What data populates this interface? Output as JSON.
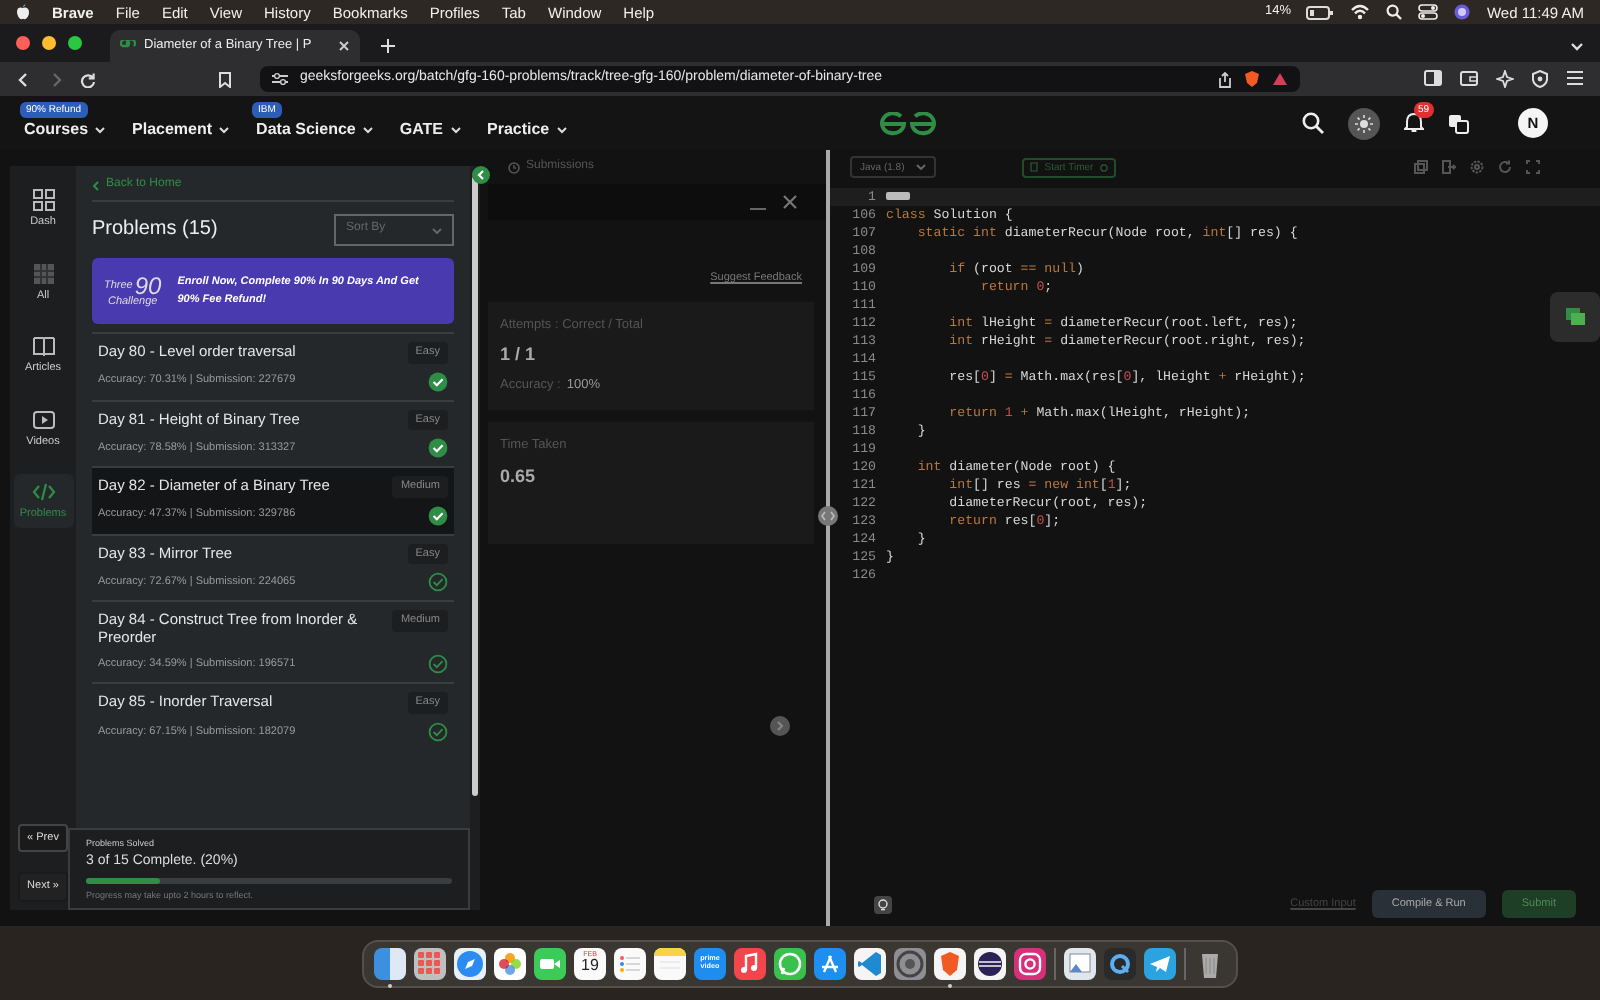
{
  "menubar": {
    "app": "Brave",
    "menus": [
      "File",
      "Edit",
      "View",
      "History",
      "Bookmarks",
      "Profiles",
      "Tab",
      "Window",
      "Help"
    ],
    "battery": "14%",
    "clock": "Wed 11:49 AM"
  },
  "browser": {
    "tab_title": "Diameter of a Binary Tree | P",
    "url": "geeksforgeeks.org/batch/gfg-160-problems/track/tree-gfg-160/problem/diameter-of-binary-tree"
  },
  "site_nav": {
    "items": [
      {
        "label": "Courses",
        "badge": "90% Refund"
      },
      {
        "label": "Placement"
      },
      {
        "label": "Data Science",
        "badge": "IBM"
      },
      {
        "label": "GATE"
      },
      {
        "label": "Practice"
      }
    ],
    "notifications": "59",
    "avatar": "N"
  },
  "sidebar": {
    "items": [
      {
        "kind": "dash",
        "label": "Dash",
        "selected": false
      },
      {
        "kind": "all",
        "label": "All",
        "selected": false
      },
      {
        "kind": "articles",
        "label": "Articles",
        "selected": false
      },
      {
        "kind": "videos",
        "label": "Videos",
        "selected": false
      },
      {
        "kind": "problems",
        "label": "Problems",
        "selected": true
      }
    ],
    "prev": "« Prev",
    "next": "Next »"
  },
  "problems": {
    "back": "Back to Home",
    "title": "Problems (15)",
    "sort_placeholder": "Sort By",
    "banner": {
      "logo_top": "Three",
      "logo_number": "90",
      "logo_bottom": "Challenge",
      "message": "Enroll Now, Complete 90% In 90 Days And Get 90% Fee Refund!"
    },
    "items": [
      {
        "title": "Day 80 - Level order traversal",
        "difficulty": "Easy",
        "stats": "Accuracy: 70.31% | Submission: 227679",
        "solved": true,
        "selected": false
      },
      {
        "title": "Day 81 - Height of Binary Tree",
        "difficulty": "Easy",
        "stats": "Accuracy: 78.58% | Submission: 313327",
        "solved": true,
        "selected": false
      },
      {
        "title": "Day 82 - Diameter of a Binary Tree",
        "difficulty": "Medium",
        "stats": "Accuracy: 47.37% | Submission: 329786",
        "solved": true,
        "selected": true
      },
      {
        "title": "Day 83 - Mirror Tree",
        "difficulty": "Easy",
        "stats": "Accuracy: 72.67% | Submission: 224065",
        "solved": false,
        "selected": false
      },
      {
        "title": "Day 84 - Construct Tree from Inorder & Preorder",
        "difficulty": "Medium",
        "stats": "Accuracy: 34.59% | Submission: 196571",
        "solved": false,
        "selected": false
      },
      {
        "title": "Day 85 - Inorder Traversal",
        "difficulty": "Easy",
        "stats": "Accuracy: 67.15% | Submission: 182079",
        "solved": false,
        "selected": false
      }
    ],
    "progress": {
      "label": "Problems Solved",
      "text": "3 of 15 Complete. (20%)",
      "level": 0.2,
      "note": "Progress may take upto 2 hours to reflect."
    }
  },
  "result": {
    "tab": "Submissions",
    "link": "Suggest Feedback",
    "cards": [
      {
        "label": "Attempts : Correct / Total",
        "value": "1 / 1",
        "sub_label": "Accuracy :",
        "sub_value": "100%"
      },
      {
        "label": "Time Taken",
        "value": "0.65"
      }
    ]
  },
  "editor": {
    "language": "Java (1.8)",
    "timer": "Start Timer",
    "lines": [
      {
        "num": "1"
      },
      {
        "num": "106",
        "tokens": [
          {
            "kind": "keyword",
            "text": "class"
          },
          {
            "kind": "plain",
            "text": " Solution {"
          }
        ]
      },
      {
        "num": "107",
        "tokens": [
          {
            "kind": "keyword",
            "text": "    static int"
          },
          {
            "kind": "plain",
            "text": " diameterRecur(Node root, "
          },
          {
            "kind": "keyword",
            "text": "int"
          },
          {
            "kind": "plain",
            "text": "[] res) {"
          }
        ]
      },
      {
        "num": "108"
      },
      {
        "num": "109",
        "tokens": [
          {
            "kind": "keyword",
            "text": "        if"
          },
          {
            "kind": "plain",
            "text": " (root "
          },
          {
            "kind": "operator",
            "text": "=="
          },
          {
            "kind": "keyword",
            "text": " null"
          },
          {
            "kind": "plain",
            "text": ")"
          }
        ]
      },
      {
        "num": "110",
        "tokens": [
          {
            "kind": "keyword",
            "text": "            return"
          },
          {
            "kind": "number",
            "text": " 0"
          },
          {
            "kind": "plain",
            "text": ";"
          }
        ]
      },
      {
        "num": "111"
      },
      {
        "num": "112",
        "tokens": [
          {
            "kind": "keyword",
            "text": "        int"
          },
          {
            "kind": "plain",
            "text": " lHeight "
          },
          {
            "kind": "operator",
            "text": "="
          },
          {
            "kind": "plain",
            "text": " diameterRecur(root.left, res);"
          }
        ]
      },
      {
        "num": "113",
        "tokens": [
          {
            "kind": "keyword",
            "text": "        int"
          },
          {
            "kind": "plain",
            "text": " rHeight "
          },
          {
            "kind": "operator",
            "text": "="
          },
          {
            "kind": "plain",
            "text": " diameterRecur(root.right, res);"
          }
        ]
      },
      {
        "num": "114"
      },
      {
        "num": "115",
        "tokens": [
          {
            "kind": "plain",
            "text": "        res["
          },
          {
            "kind": "number",
            "text": "0"
          },
          {
            "kind": "plain",
            "text": "] "
          },
          {
            "kind": "operator",
            "text": "="
          },
          {
            "kind": "plain",
            "text": " Math.max(res["
          },
          {
            "kind": "number",
            "text": "0"
          },
          {
            "kind": "plain",
            "text": "], lHeight "
          },
          {
            "kind": "operator",
            "text": "+"
          },
          {
            "kind": "plain",
            "text": " rHeight);"
          }
        ]
      },
      {
        "num": "116"
      },
      {
        "num": "117",
        "tokens": [
          {
            "kind": "keyword",
            "text": "        return"
          },
          {
            "kind": "number",
            "text": " 1"
          },
          {
            "kind": "operator",
            "text": " +"
          },
          {
            "kind": "plain",
            "text": " Math.max(lHeight, rHeight);"
          }
        ]
      },
      {
        "num": "118",
        "tokens": [
          {
            "kind": "plain",
            "text": "    }"
          }
        ]
      },
      {
        "num": "119"
      },
      {
        "num": "120",
        "tokens": [
          {
            "kind": "keyword",
            "text": "    int"
          },
          {
            "kind": "plain",
            "text": " diameter(Node root) {"
          }
        ]
      },
      {
        "num": "121",
        "tokens": [
          {
            "kind": "keyword",
            "text": "        int"
          },
          {
            "kind": "plain",
            "text": "[] res "
          },
          {
            "kind": "operator",
            "text": "="
          },
          {
            "kind": "keyword",
            "text": " new int"
          },
          {
            "kind": "plain",
            "text": "["
          },
          {
            "kind": "number",
            "text": "1"
          },
          {
            "kind": "plain",
            "text": "];"
          }
        ]
      },
      {
        "num": "122",
        "tokens": [
          {
            "kind": "plain",
            "text": "        diameterRecur(root, res);"
          }
        ]
      },
      {
        "num": "123",
        "tokens": [
          {
            "kind": "keyword",
            "text": "        return"
          },
          {
            "kind": "plain",
            "text": " res["
          },
          {
            "kind": "number",
            "text": "0"
          },
          {
            "kind": "plain",
            "text": "];"
          }
        ]
      },
      {
        "num": "124",
        "tokens": [
          {
            "kind": "plain",
            "text": "    }"
          }
        ]
      },
      {
        "num": "125",
        "tokens": [
          {
            "kind": "plain",
            "text": "}"
          }
        ]
      },
      {
        "num": "126"
      }
    ],
    "custom_input": "Custom Input",
    "compile": "Compile & Run",
    "submit": "Submit"
  },
  "dock": [
    {
      "kind": "finder",
      "running": true
    },
    {
      "kind": "launchpad",
      "running": false
    },
    {
      "kind": "safari",
      "running": false
    },
    {
      "kind": "photos",
      "running": false
    },
    {
      "kind": "facetime",
      "running": false
    },
    {
      "kind": "calendar",
      "month": "FEB",
      "day": "19",
      "running": false
    },
    {
      "kind": "reminders",
      "running": false
    },
    {
      "kind": "notes",
      "running": false
    },
    {
      "kind": "prime_video",
      "label": "prime video",
      "running": false
    },
    {
      "kind": "music",
      "running": false
    },
    {
      "kind": "whatsapp",
      "running": false
    },
    {
      "kind": "app_store",
      "running": false
    },
    {
      "kind": "vscode",
      "running": false
    },
    {
      "kind": "settings",
      "running": false
    },
    {
      "kind": "brave",
      "running": true
    },
    {
      "kind": "eclipse",
      "running": false
    },
    {
      "kind": "instagram",
      "running": false
    },
    {
      "kind": "separator"
    },
    {
      "kind": "preview",
      "running": false
    },
    {
      "kind": "quicktime",
      "running": false
    },
    {
      "kind": "telegram",
      "running": false
    },
    {
      "kind": "separator"
    },
    {
      "kind": "trash",
      "running": false
    }
  ]
}
